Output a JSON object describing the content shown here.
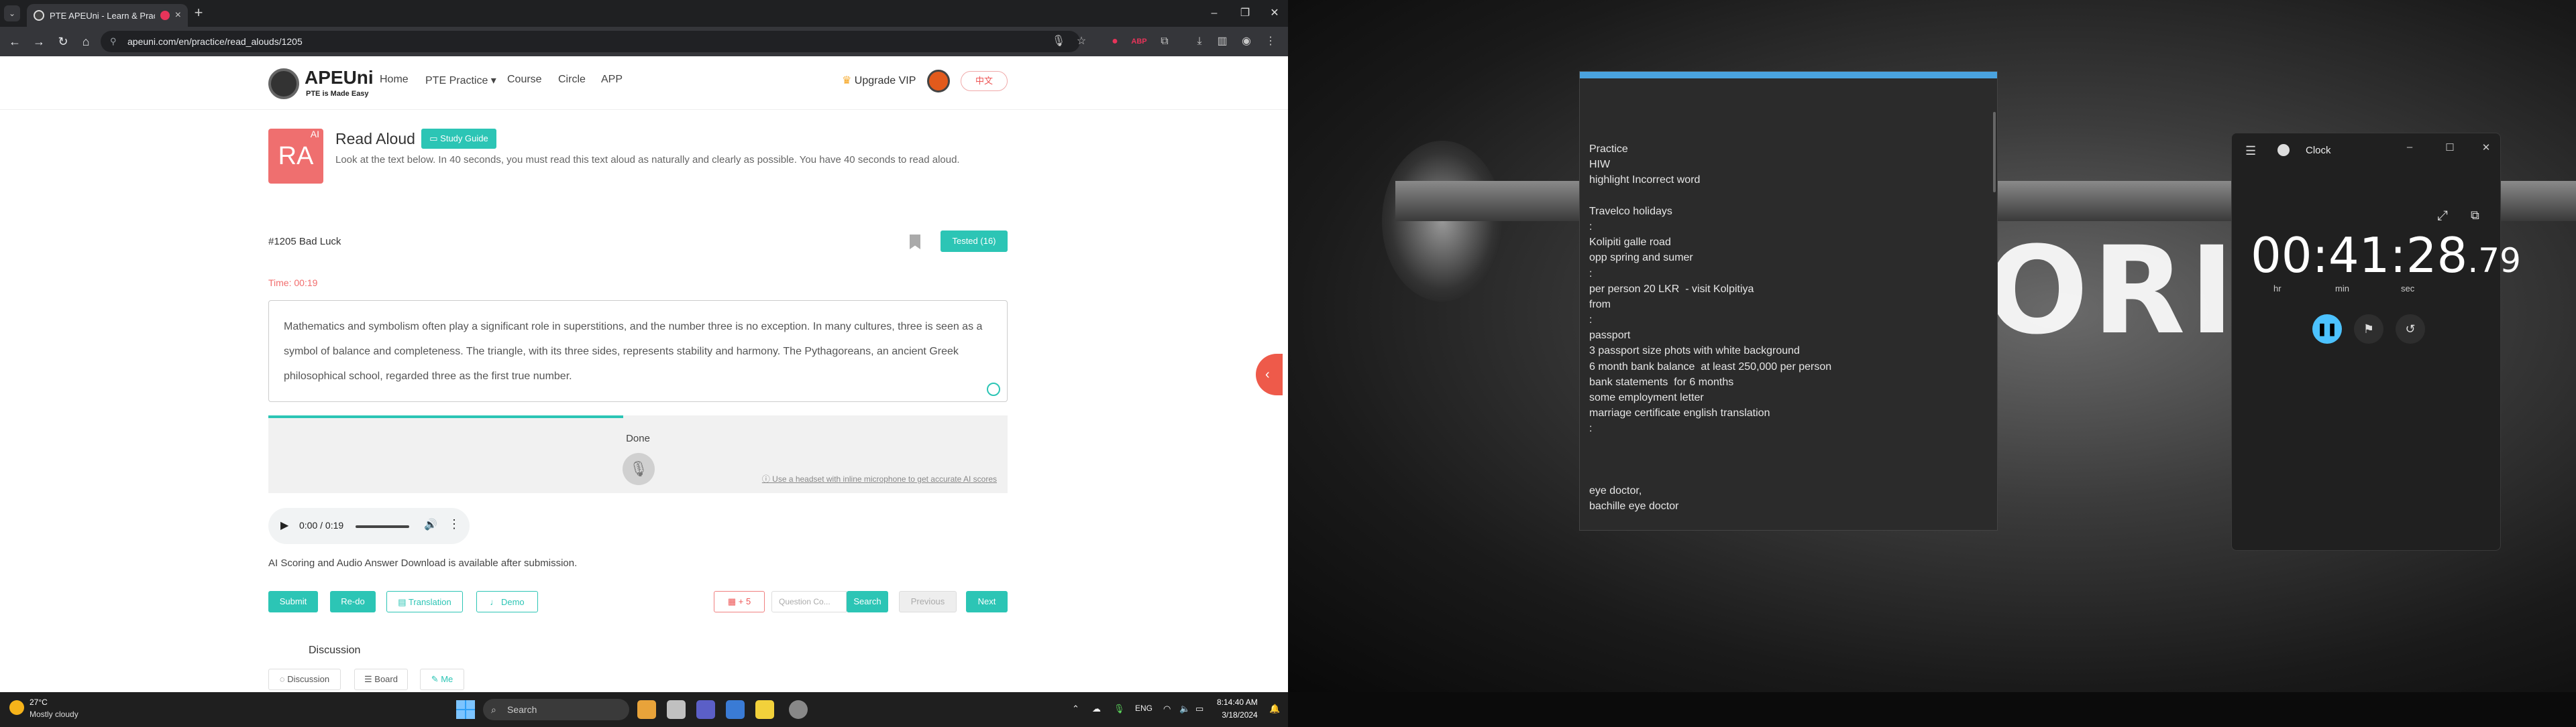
{
  "browser": {
    "tab_title": "PTE APEUni - Learn & Prac",
    "url": "apeuni.com/en/practice/read_alouds/1205"
  },
  "site": {
    "logo_name": "APEUni",
    "logo_tag": "PTE is Made Easy",
    "nav": [
      "Home",
      "PTE Practice ▾",
      "Course",
      "Circle",
      "APP"
    ],
    "upgrade": "Upgrade VIP",
    "lang": "中文"
  },
  "question": {
    "icon_text": "RA",
    "icon_ai": "AI",
    "title": "Read Aloud",
    "study_guide": "Study Guide",
    "description": "Look at the text below. In 40 seconds, you must read this text aloud as naturally and clearly as possible. You have 40 seconds to read aloud.",
    "number": "#1205 Bad Luck",
    "tested": "Tested (16)",
    "timer": "Time: 00:19",
    "passage": "Mathematics and symbolism often play a significant role in superstitions, and the number three is no exception. In many cultures, three is seen as a symbol of balance and completeness. The triangle, with its three sides, represents stability and harmony. The Pythagoreans, an ancient Greek philosophical school, regarded three as the first true number.",
    "record_status": "Done",
    "record_progress": 0.48,
    "headset_hint": "ⓘ Use a headset with inline microphone to get accurate AI scores",
    "audio_time": "0:00 / 0:19",
    "ai_note": "AI Scoring and Audio Answer Download is available after submission."
  },
  "actions": {
    "submit": "Submit",
    "redo": "Re-do",
    "translation": "Translation",
    "demo": "Demo",
    "flag": "+ 5",
    "search_placeholder": "Question Co...",
    "search": "Search",
    "previous": "Previous",
    "next": "Next"
  },
  "discussion": {
    "title": "Discussion",
    "tabs": [
      "Discussion",
      "Board",
      "Me"
    ]
  },
  "notepad": {
    "lines": [
      "Practice",
      "HIW",
      "highlight Incorrect word",
      "",
      "Travelco holidays",
      ":",
      "Kolipiti galle road",
      "opp spring and sumer",
      ":",
      "per person 20 LKR  - visit Kolpitiya",
      "from",
      ":",
      "passport",
      "3 passport size phots with white background",
      "6 month bank balance  at least 250,000 per person",
      "bank statements  for 6 months",
      "some employment letter",
      "marriage certificate english translation",
      ":",
      "",
      "",
      "",
      "eye doctor,",
      "bachille eye doctor"
    ]
  },
  "clock_app": {
    "title": "Clock",
    "time_main": "00:41:28",
    "time_ms": ".79",
    "labels": [
      "hr",
      "min",
      "sec"
    ]
  },
  "wallpaper": {
    "text": "ORI"
  },
  "taskbar": {
    "temp": "27°C",
    "weather": "Mostly cloudy",
    "search": "Search",
    "lang": "ENG",
    "time": "8:14:40 AM",
    "date": "3/18/2024"
  },
  "colors": {
    "accent": "#2cc5b5",
    "danger": "#ef6f6f",
    "clock_accent": "#4cc2ff"
  }
}
